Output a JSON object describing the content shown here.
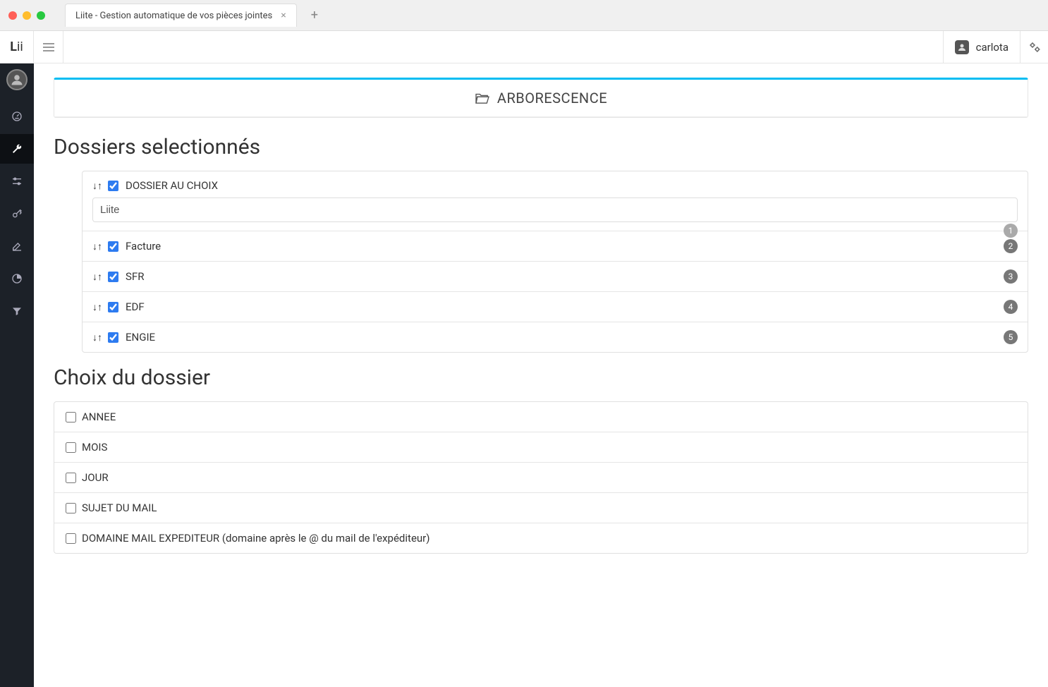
{
  "browser": {
    "tab_title": "Liite - Gestion automatique de vos pièces jointes"
  },
  "topbar": {
    "logo_bold": "L",
    "logo_rest": "ii",
    "username": "carlota"
  },
  "panel": {
    "title": "ARBORESCENCE"
  },
  "sections": {
    "selected_title": "Dossiers selectionnés",
    "choice_title": "Choix du dossier"
  },
  "selected_folders": {
    "custom_label": "DOSSIER AU CHOIX",
    "custom_value": "Liite",
    "custom_badge": "1",
    "items": [
      {
        "label": "Facture",
        "badge": "2"
      },
      {
        "label": "SFR",
        "badge": "3"
      },
      {
        "label": "EDF",
        "badge": "4"
      },
      {
        "label": "ENGIE",
        "badge": "5"
      }
    ]
  },
  "folder_choices": [
    {
      "label": "ANNEE"
    },
    {
      "label": "MOIS"
    },
    {
      "label": "JOUR"
    },
    {
      "label": "SUJET DU MAIL"
    },
    {
      "label": "DOMAINE MAIL EXPEDITEUR (domaine après le @ du mail de l'expéditeur)"
    }
  ]
}
